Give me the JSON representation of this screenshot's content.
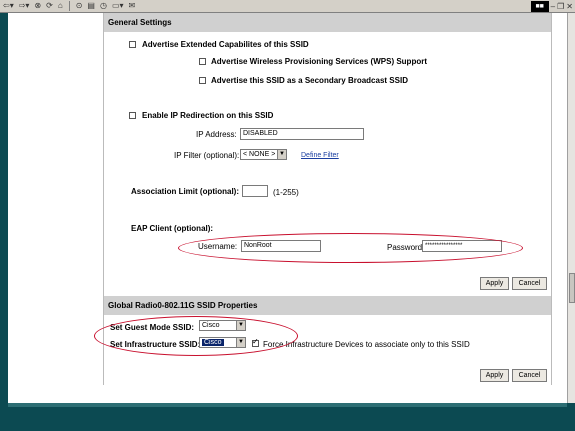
{
  "toolbar": {
    "icons": [
      "back-icon",
      "forward-icon",
      "stop-icon",
      "refresh-icon",
      "home-icon",
      "search-icon",
      "favorites-icon",
      "history-icon",
      "print-icon",
      "mail-icon"
    ],
    "window_logo": "■■"
  },
  "general": {
    "header": "General Settings",
    "advertise_ext": "Advertise Extended Capabilites of this SSID",
    "wps": "Advertise Wireless Provisioning Services (WPS) Support",
    "secondary_broadcast": "Advertise this SSID as a Secondary Broadcast SSID",
    "ip_redirection": "Enable IP Redirection on this SSID",
    "ip_address_label": "IP Address:",
    "ip_address_value": "DISABLED",
    "ip_filter_label": "IP Filter (optional):",
    "ip_filter_value": "< NONE >",
    "define_filter": "Define Filter",
    "assoc_limit_label": "Association Limit (optional):",
    "assoc_limit_value": "",
    "assoc_limit_range": "(1-255)",
    "eap_label": "EAP Client (optional):",
    "username_label": "Username:",
    "username_value": "NonRoot",
    "password_label": "Password:",
    "password_value": "****************",
    "apply": "Apply",
    "cancel": "Cancel"
  },
  "global": {
    "header": "Global Radio0-802.11G SSID Properties",
    "guest_label": "Set Guest Mode SSID:",
    "guest_value": "Cisco",
    "infra_label": "Set Infrastructure SSID:",
    "infra_value": "Cisco",
    "force_infra": "Force Infrastructure Devices to associate only to this SSID",
    "force_infra_checked": true,
    "apply": "Apply",
    "cancel": "Cancel"
  },
  "annotation_color": "#c8102e"
}
